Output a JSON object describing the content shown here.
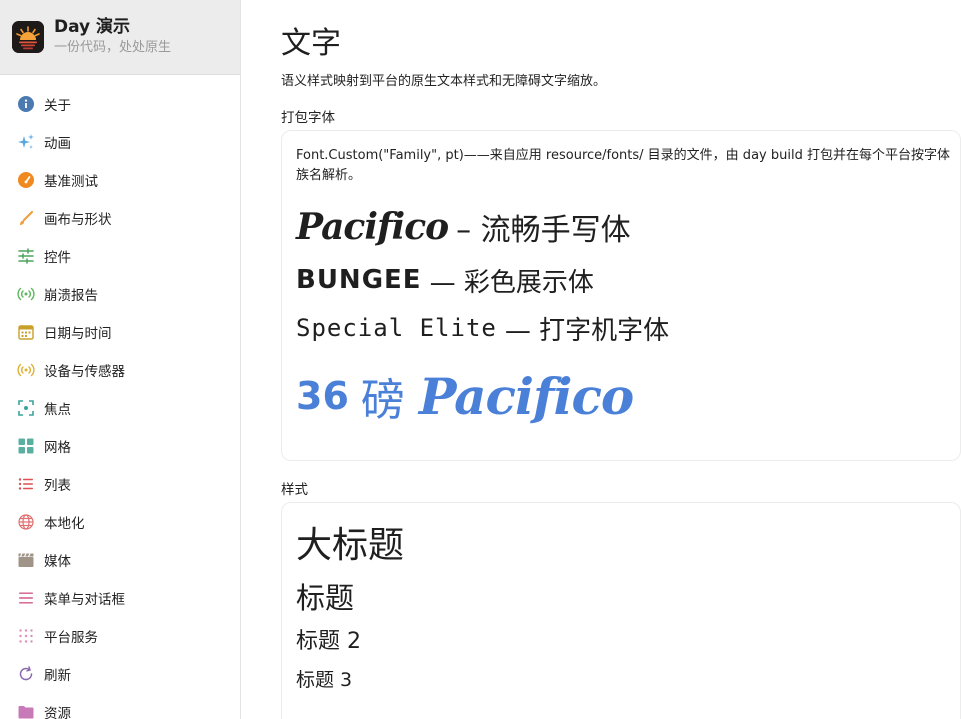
{
  "app": {
    "name": "Day 演示",
    "subtitle": "一份代码，处处原生"
  },
  "sidebar": {
    "items": [
      {
        "label": "关于",
        "icon": "info-icon",
        "color": "#4a7ab0"
      },
      {
        "label": "动画",
        "icon": "sparkles-icon",
        "color": "#5aa6e0"
      },
      {
        "label": "基准测试",
        "icon": "gauge-icon",
        "color": "#f08a1e"
      },
      {
        "label": "画布与形状",
        "icon": "brush-icon",
        "color": "#f0a040"
      },
      {
        "label": "控件",
        "icon": "sliders-icon",
        "color": "#4aa35a"
      },
      {
        "label": "崩溃报告",
        "icon": "broadcast-icon",
        "color": "#5cb85c"
      },
      {
        "label": "日期与时间",
        "icon": "calendar-icon",
        "color": "#c8a02a"
      },
      {
        "label": "设备与传感器",
        "icon": "sensor-icon",
        "color": "#e0b030"
      },
      {
        "label": "焦点",
        "icon": "focus-icon",
        "color": "#3aa39a"
      },
      {
        "label": "网格",
        "icon": "grid-icon",
        "color": "#5ab0a0"
      },
      {
        "label": "列表",
        "icon": "list-icon",
        "color": "#e05050"
      },
      {
        "label": "本地化",
        "icon": "globe-icon",
        "color": "#e07070"
      },
      {
        "label": "媒体",
        "icon": "clapper-icon",
        "color": "#a09488"
      },
      {
        "label": "菜单与对话框",
        "icon": "menu-icon",
        "color": "#d05a8a"
      },
      {
        "label": "平台服务",
        "icon": "dots-grid-icon",
        "color": "#e090b8"
      },
      {
        "label": "刷新",
        "icon": "refresh-icon",
        "color": "#8a6ab0"
      },
      {
        "label": "资源",
        "icon": "folder-icon",
        "color": "#c87ab8"
      }
    ]
  },
  "main": {
    "title": "文字",
    "description": "语义样式映射到平台的原生文本样式和无障碍文字缩放。",
    "bundled": {
      "label": "打包字体",
      "note": "Font.Custom(\"Family\", pt)——来自应用 resource/fonts/ 目录的文件，由 day build 打包并在每个平台按字体族名解析。",
      "samples": [
        {
          "font": "Pacifico",
          "desc": " – 流畅手写体"
        },
        {
          "font": "BUNGEE",
          "desc": " — 彩色展示体"
        },
        {
          "font": "Special Elite",
          "desc": " — 打字机字体"
        }
      ],
      "big_sample": {
        "size": "36",
        "unit": "磅",
        "font": "Pacifico",
        "color": "#4a80d8"
      }
    },
    "styles": {
      "label": "样式",
      "items": [
        "大标题",
        "标题",
        "标题 2",
        "标题 3"
      ]
    }
  }
}
